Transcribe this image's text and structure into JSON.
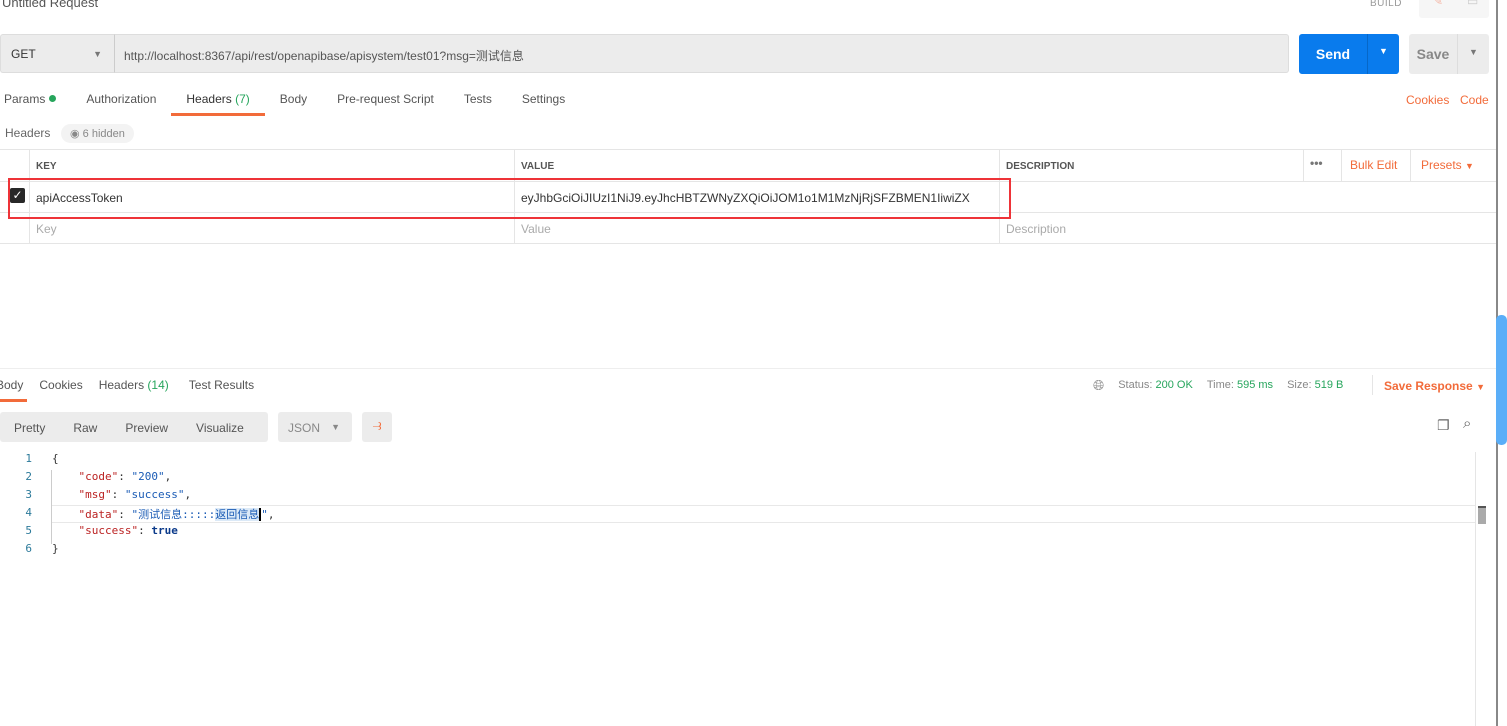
{
  "request": {
    "title": "Untitled Request",
    "build_label": "BUILD",
    "method": "GET",
    "url": "http://localhost:8367/api/rest/openapibase/apisystem/test01?msg=测试信息",
    "send_label": "Send",
    "save_label": "Save"
  },
  "tabs": [
    {
      "label": "Params"
    },
    {
      "label": "Authorization"
    },
    {
      "label": "Headers",
      "count": "(7)"
    },
    {
      "label": "Body"
    },
    {
      "label": "Pre-request Script"
    },
    {
      "label": "Tests"
    },
    {
      "label": "Settings"
    }
  ],
  "links": {
    "cookies": "Cookies",
    "code": "Code"
  },
  "headers": {
    "label": "Headers",
    "hidden": "6 hidden",
    "columns": {
      "key": "KEY",
      "value": "VALUE",
      "description": "DESCRIPTION"
    },
    "bulk_edit": "Bulk Edit",
    "presets": "Presets",
    "rows": [
      {
        "checked": true,
        "key": "apiAccessToken",
        "value": "eyJhbGciOiJIUzI1NiJ9.eyJhcHBTZWNyZXQiOiJOM1o1M1MzNjRjSFZBMEN1IiwiZX",
        "description": ""
      }
    ],
    "placeholder": {
      "key": "Key",
      "value": "Value",
      "description": "Description"
    }
  },
  "response": {
    "tabs": [
      {
        "label": "Body"
      },
      {
        "label": "Cookies"
      },
      {
        "label": "Headers",
        "count": "(14)"
      },
      {
        "label": "Test Results"
      }
    ],
    "status_label": "Status:",
    "status": "200 OK",
    "time_label": "Time:",
    "time": "595 ms",
    "size_label": "Size:",
    "size": "519 B",
    "save_response": "Save Response",
    "views": [
      "Pretty",
      "Raw",
      "Preview",
      "Visualize"
    ],
    "format": "JSON",
    "lines": [
      "1",
      "2",
      "3",
      "4",
      "5",
      "6"
    ],
    "body": {
      "code_key": "\"code\"",
      "code_val": "\"200\"",
      "msg_key": "\"msg\"",
      "msg_val": "\"success\"",
      "data_key": "\"data\"",
      "data_val_a": "\"测试信息:::::",
      "data_val_b": "返回信息",
      "data_val_c": "\"",
      "success_key": "\"success\"",
      "success_val": "true"
    }
  },
  "colors": {
    "accent": "#f26b3a",
    "send": "#097bed",
    "ok": "#26a55c"
  }
}
